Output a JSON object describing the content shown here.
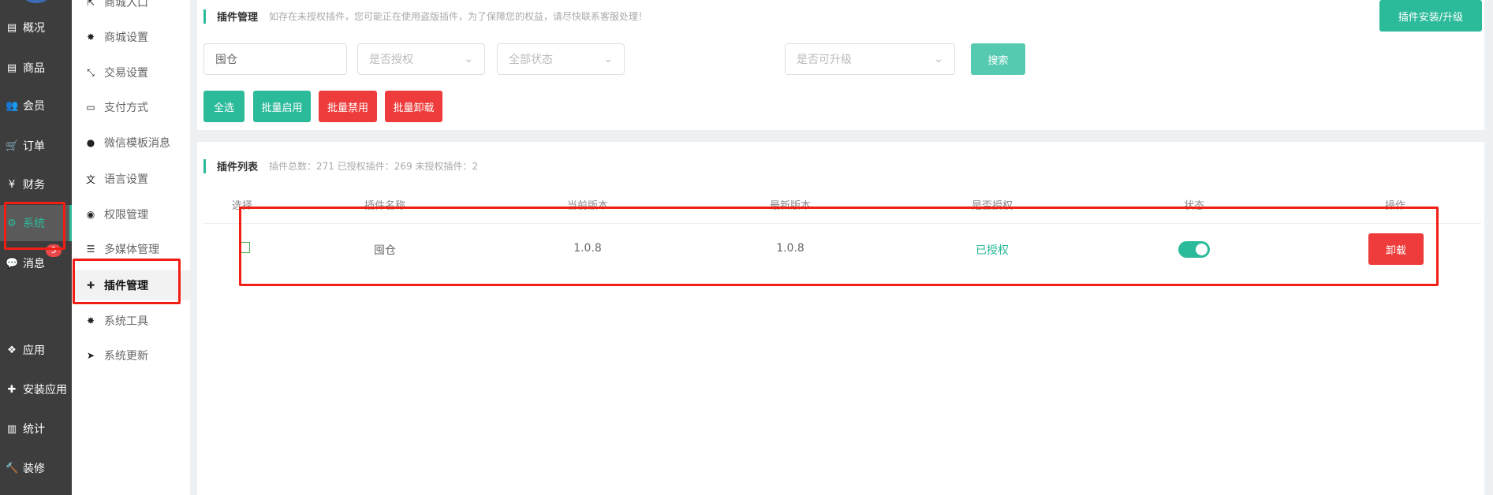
{
  "sidebar": {
    "items": [
      {
        "label": "概况",
        "icon": "archive-icon"
      },
      {
        "label": "商品",
        "icon": "archive-icon"
      },
      {
        "label": "会员",
        "icon": "users-icon"
      },
      {
        "label": "订单",
        "icon": "cart-icon"
      },
      {
        "label": "财务",
        "icon": "yen-icon"
      },
      {
        "label": "系统",
        "icon": "cogs-icon",
        "active": true
      },
      {
        "label": "消息",
        "icon": "comment-icon"
      },
      {
        "label": "应用",
        "icon": "cubes-icon"
      },
      {
        "label": "安装应用",
        "icon": "puzzle-icon"
      },
      {
        "label": "统计",
        "icon": "bar-chart-icon"
      },
      {
        "label": "装修",
        "icon": "gavel-icon"
      }
    ],
    "badge": "5"
  },
  "submenu": {
    "items": [
      {
        "label": "商城入口"
      },
      {
        "label": "商城设置"
      },
      {
        "label": "交易设置"
      },
      {
        "label": "支付方式"
      },
      {
        "label": "微信模板消息"
      },
      {
        "label": "语言设置"
      },
      {
        "label": "权限管理"
      },
      {
        "label": "多媒体管理"
      },
      {
        "label": "插件管理",
        "active": true
      },
      {
        "label": "系统工具"
      },
      {
        "label": "系统更新"
      }
    ]
  },
  "header": {
    "title": "插件管理",
    "notice": "如存在未授权插件，您可能正在使用盗版插件，为了保障您的权益，请尽快联系客服处理！",
    "install_button": "插件安装/升级"
  },
  "filters": {
    "keyword": "囤仓",
    "authorized_placeholder": "是否授权",
    "status_placeholder": "全部状态",
    "upgradable_placeholder": "是否可升级",
    "search_button": "搜索"
  },
  "actions": {
    "select_all": "全选",
    "batch_enable": "批量启用",
    "batch_disable": "批量禁用",
    "batch_uninstall": "批量卸载"
  },
  "list": {
    "title": "插件列表",
    "summary": "插件总数：271 已授权插件：269 未授权插件：2",
    "columns": [
      "选择",
      "插件名称",
      "当前版本",
      "最新版本",
      "是否授权",
      "状态",
      "操作"
    ],
    "rows": [
      {
        "name": "囤仓",
        "current_version": "1.0.8",
        "latest_version": "1.0.8",
        "authorized": "已授权",
        "enabled": true,
        "action": "卸载"
      }
    ]
  },
  "colors": {
    "accent": "#2bba9a",
    "danger": "#ee3b3b",
    "highlight": "#f01e14"
  }
}
